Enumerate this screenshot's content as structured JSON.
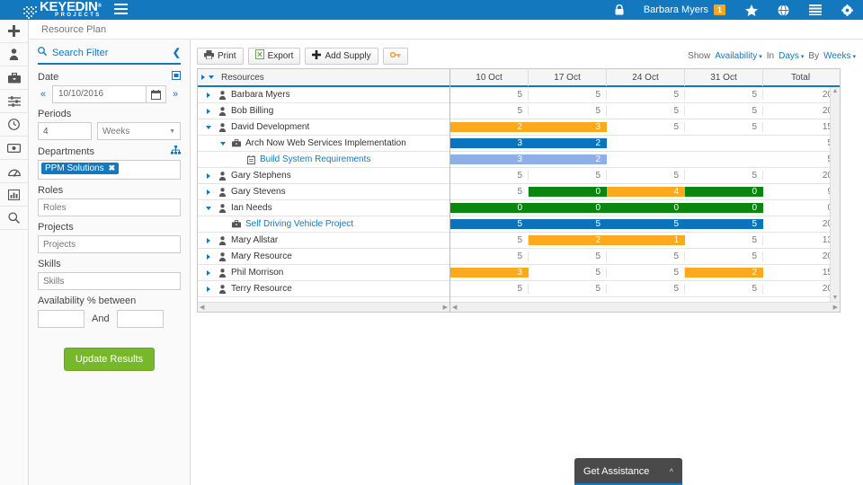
{
  "header": {
    "logo_text": "KEYEDIN",
    "logo_sub": "PROJECTS",
    "menu_icon": "hamburger-icon",
    "lock_icon": "lock-icon",
    "username": "Barbara Myers",
    "badge_count": "1",
    "star_icon": "star-icon",
    "globe_icon": "globe-icon",
    "list_icon": "list-icon",
    "gear_icon": "gear-icon",
    "brand_color": "#1478be"
  },
  "rail": {
    "items": [
      {
        "icon": "plus-icon",
        "name": "add"
      },
      {
        "icon": "person-icon",
        "name": "people"
      },
      {
        "icon": "briefcase-icon",
        "name": "projects"
      },
      {
        "icon": "sliders-icon",
        "name": "settings"
      },
      {
        "icon": "clock-icon",
        "name": "time"
      },
      {
        "icon": "money-icon",
        "name": "finance"
      },
      {
        "icon": "gauge-icon",
        "name": "dashboard"
      },
      {
        "icon": "bar-chart-icon",
        "name": "reports"
      },
      {
        "icon": "search-icon",
        "name": "search"
      }
    ]
  },
  "page": {
    "title": "Resource Plan"
  },
  "filter": {
    "heading": "Search Filter",
    "search_icon": "search-icon",
    "collapse_icon": "chevron-left-icon",
    "date_label": "Date",
    "date_ico": "calendar-picker-icon",
    "date_prev": "«",
    "date_next": "»",
    "date_value": "10/10/2016",
    "calendar_icon": "calendar-icon",
    "periods_label": "Periods",
    "periods_value": "4",
    "periods_unit": "Weeks",
    "departments_label": "Departments",
    "departments_ico": "org-chart-icon",
    "department_tag": "PPM Solutions",
    "tag_remove": "✖",
    "roles_label": "Roles",
    "roles_placeholder": "Roles",
    "roles_value": "",
    "projects_label": "Projects",
    "projects_placeholder": "Projects",
    "projects_value": "",
    "skills_label": "Skills",
    "skills_placeholder": "Skills",
    "skills_value": "",
    "availability_label": "Availability % between",
    "availability_from": "",
    "availability_and": "And",
    "availability_to": "",
    "update_button": "Update Results",
    "update_color": "#76b82a"
  },
  "toolbar": {
    "print": "Print",
    "print_icon": "printer-icon",
    "export": "Export",
    "export_icon": "spreadsheet-icon",
    "add_supply": "Add Supply",
    "add_supply_icon": "plus-icon",
    "key_icon": "key-icon",
    "show_label": "Show",
    "show_value": "Availability",
    "in_label": "In",
    "in_value": "Days",
    "by_label": "By",
    "by_value": "Weeks",
    "caret": "▾"
  },
  "grid": {
    "resources_header": "Resources",
    "columns": [
      "10 Oct",
      "17 Oct",
      "24 Oct",
      "31 Oct"
    ],
    "total_header": "Total",
    "rows": [
      {
        "name": "Barbara Myers",
        "indent": 0,
        "tree": "right",
        "icon": "person-icon",
        "link": false,
        "values": [
          "5",
          "5",
          "5",
          "5"
        ],
        "colors": [
          "",
          "",
          "",
          ""
        ],
        "total": "20"
      },
      {
        "name": "Bob Billing",
        "indent": 0,
        "tree": "right",
        "icon": "person-icon",
        "link": false,
        "values": [
          "5",
          "5",
          "5",
          "5"
        ],
        "colors": [
          "",
          "",
          "",
          ""
        ],
        "total": "20"
      },
      {
        "name": "David Development",
        "indent": 0,
        "tree": "down",
        "icon": "person-icon",
        "link": false,
        "values": [
          "2",
          "3",
          "5",
          "5"
        ],
        "colors": [
          "#fca91e",
          "#fca91e",
          "",
          ""
        ],
        "total": "15"
      },
      {
        "name": "Arch Now Web Services Implementation",
        "indent": 1,
        "tree": "down",
        "icon": "briefcase-icon",
        "link": false,
        "values": [
          "3",
          "2",
          "",
          ""
        ],
        "colors": [
          "#0973be",
          "#0973be",
          "",
          ""
        ],
        "total": "5"
      },
      {
        "name": "Build System Requirements",
        "indent": 2,
        "tree": "none",
        "icon": "task-icon",
        "link": true,
        "values": [
          "3",
          "2",
          "",
          ""
        ],
        "colors": [
          "#8eb0e8",
          "#8eb0e8",
          "",
          ""
        ],
        "total": "5"
      },
      {
        "name": "Gary Stephens",
        "indent": 0,
        "tree": "right",
        "icon": "person-icon",
        "link": false,
        "values": [
          "5",
          "5",
          "5",
          "5"
        ],
        "colors": [
          "",
          "",
          "",
          ""
        ],
        "total": "20"
      },
      {
        "name": "Gary Stevens",
        "indent": 0,
        "tree": "right",
        "icon": "person-icon",
        "link": false,
        "values": [
          "5",
          "0",
          "4",
          "0"
        ],
        "colors": [
          "",
          "#0a8510",
          "#fca91e",
          "#0a8510"
        ],
        "total": "9"
      },
      {
        "name": "Ian Needs",
        "indent": 0,
        "tree": "down",
        "icon": "person-icon",
        "link": false,
        "values": [
          "0",
          "0",
          "0",
          "0"
        ],
        "colors": [
          "#0a8510",
          "#0a8510",
          "#0a8510",
          "#0a8510"
        ],
        "total": "0"
      },
      {
        "name": "Self Driving Vehicle Project",
        "indent": 1,
        "tree": "none",
        "icon": "briefcase-icon",
        "link": true,
        "values": [
          "5",
          "5",
          "5",
          "5"
        ],
        "colors": [
          "#0973be",
          "#0973be",
          "#0973be",
          "#0973be"
        ],
        "total": "20"
      },
      {
        "name": "Mary Allstar",
        "indent": 0,
        "tree": "right",
        "icon": "person-icon",
        "link": false,
        "values": [
          "5",
          "2",
          "1",
          "5"
        ],
        "colors": [
          "",
          "#fca91e",
          "#fca91e",
          ""
        ],
        "total": "13"
      },
      {
        "name": "Mary Resource",
        "indent": 0,
        "tree": "right",
        "icon": "person-icon",
        "link": false,
        "values": [
          "5",
          "5",
          "5",
          "5"
        ],
        "colors": [
          "",
          "",
          "",
          ""
        ],
        "total": "20"
      },
      {
        "name": "Phil Morrison",
        "indent": 0,
        "tree": "right",
        "icon": "person-icon",
        "link": false,
        "values": [
          "3",
          "5",
          "5",
          "2"
        ],
        "colors": [
          "#fca91e",
          "",
          "",
          "#fca91e"
        ],
        "total": "15"
      },
      {
        "name": "Terry Resource",
        "indent": 0,
        "tree": "right",
        "icon": "person-icon",
        "link": false,
        "values": [
          "5",
          "5",
          "5",
          "5"
        ],
        "colors": [
          "",
          "",
          "",
          ""
        ],
        "total": "20"
      }
    ]
  },
  "assistance": {
    "label": "Get Assistance",
    "caret": "⌃"
  }
}
